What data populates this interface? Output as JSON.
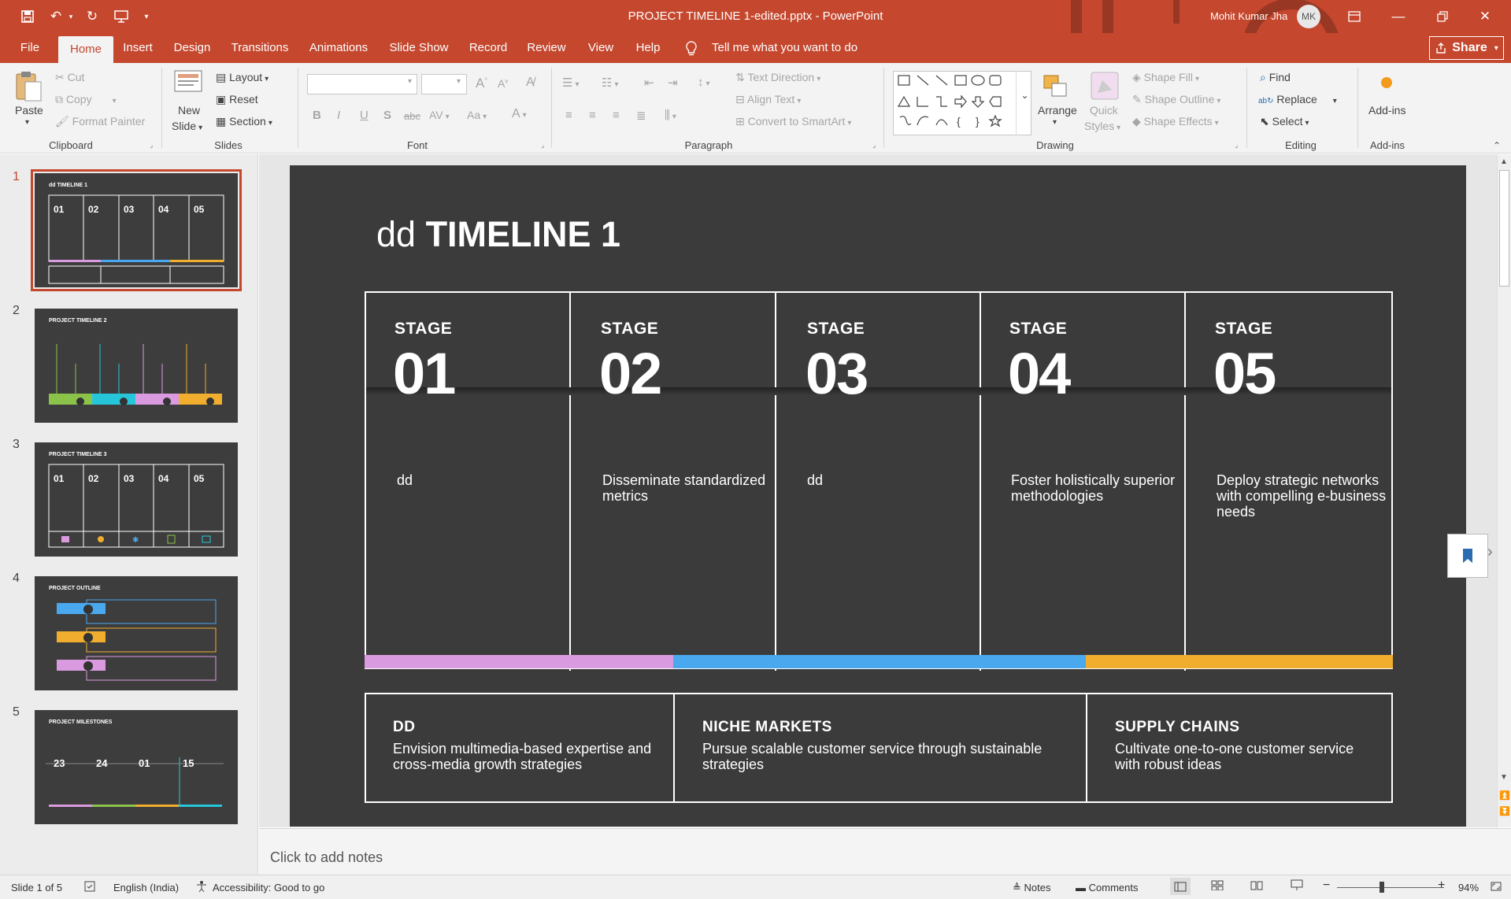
{
  "titlebar": {
    "document_title": "PROJECT TIMELINE 1-edited.pptx  -  PowerPoint",
    "user_name": "Mohit Kumar Jha",
    "user_initials": "MK"
  },
  "menu": {
    "tabs": [
      "File",
      "Home",
      "Insert",
      "Design",
      "Transitions",
      "Animations",
      "Slide Show",
      "Record",
      "Review",
      "View",
      "Help"
    ],
    "active_tab": "Home",
    "tell_me": "Tell me what you want to do",
    "share": "Share"
  },
  "ribbon": {
    "clipboard": {
      "paste": "Paste",
      "cut": "Cut",
      "copy": "Copy",
      "format_painter": "Format Painter",
      "label": "Clipboard"
    },
    "slides": {
      "new_slide_1": "New",
      "new_slide_2": "Slide",
      "layout": "Layout",
      "reset": "Reset",
      "section": "Section",
      "label": "Slides"
    },
    "font": {
      "label": "Font",
      "bold": "B",
      "italic": "I",
      "underline": "U",
      "shadow": "S",
      "strike": "abc",
      "spacing": "AV",
      "case": "Aa",
      "color": "A"
    },
    "paragraph": {
      "text_direction": "Text Direction",
      "align_text": "Align Text",
      "convert_smartart": "Convert to SmartArt",
      "label": "Paragraph"
    },
    "drawing": {
      "arrange": "Arrange",
      "quick_1": "Quick",
      "quick_2": "Styles",
      "shape_fill": "Shape Fill",
      "shape_outline": "Shape Outline",
      "shape_effects": "Shape Effects",
      "label": "Drawing"
    },
    "editing": {
      "find": "Find",
      "replace": "Replace",
      "select": "Select",
      "label": "Editing"
    },
    "addins": {
      "button": "Add-ins",
      "label": "Add-ins"
    }
  },
  "thumbnails": [
    {
      "num": "1",
      "title": "dd TIMELINE 1"
    },
    {
      "num": "2",
      "title": "PROJECT TIMELINE 2"
    },
    {
      "num": "3",
      "title": "PROJECT TIMELINE 3"
    },
    {
      "num": "4",
      "title": "PROJECT OUTLINE"
    },
    {
      "num": "5",
      "title": "PROJECT MILESTONES"
    }
  ],
  "slide": {
    "title_light": "dd ",
    "title_bold": "TIMELINE 1",
    "stages": [
      {
        "label": "STAGE",
        "num": "01",
        "desc": "dd"
      },
      {
        "label": "STAGE",
        "num": "02",
        "desc": "Disseminate standardized metrics"
      },
      {
        "label": "STAGE",
        "num": "03",
        "desc": "dd"
      },
      {
        "label": "STAGE",
        "num": "04",
        "desc": "Foster holistically superior methodologies"
      },
      {
        "label": "STAGE",
        "num": "05",
        "desc": "Deploy strategic networks with compelling e-business needs"
      }
    ],
    "bars": [
      {
        "color": "#d99ae0"
      },
      {
        "color": "#4aa8ee"
      },
      {
        "color": "#f0ad2e"
      }
    ],
    "bottom": [
      {
        "title": "DD",
        "desc": "Envision multimedia-based expertise and cross-media growth strategies"
      },
      {
        "title": "NICHE MARKETS",
        "desc": "Pursue scalable customer service through sustainable strategies"
      },
      {
        "title": "SUPPLY CHAINS",
        "desc": "Cultivate one-to-one customer service with robust ideas"
      }
    ]
  },
  "notes_placeholder": "Click to add notes",
  "status": {
    "slide_info": "Slide 1 of 5",
    "language": "English (India)",
    "accessibility": "Accessibility: Good to go",
    "notes": "Notes",
    "comments": "Comments",
    "zoom": "94%"
  },
  "colors": {
    "accent": "#c4472e",
    "slide_bg": "#3b3b3b"
  }
}
